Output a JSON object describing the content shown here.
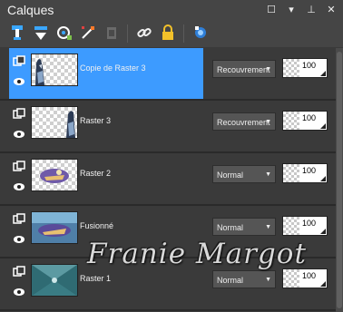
{
  "window": {
    "title": "Calques",
    "buttons": [
      "restore",
      "menu",
      "pin",
      "close"
    ]
  },
  "toolbar": {
    "icons": [
      "new-raster-layer-icon",
      "new-vector-layer-icon",
      "new-mask-layer-icon",
      "new-adjustment-layer-icon",
      "delete-layer-icon",
      "link-icon",
      "lock-icon",
      "properties-icon"
    ]
  },
  "layers": [
    {
      "name": "Copie de Raster 3",
      "blend": "Recouvrement",
      "opacity": "100",
      "selected": true
    },
    {
      "name": "Raster 3",
      "blend": "Recouvrement",
      "opacity": "100",
      "selected": false
    },
    {
      "name": "Raster 2",
      "blend": "Normal",
      "opacity": "100",
      "selected": false
    },
    {
      "name": "Fusionné",
      "blend": "Normal",
      "opacity": "100",
      "selected": false
    },
    {
      "name": "Raster 1",
      "blend": "Normal",
      "opacity": "100",
      "selected": false
    }
  ],
  "watermark": "Franie Margot",
  "colors": {
    "selection": "#3d9bff",
    "panel": "#3c3c3c",
    "titlebar": "#454545"
  }
}
